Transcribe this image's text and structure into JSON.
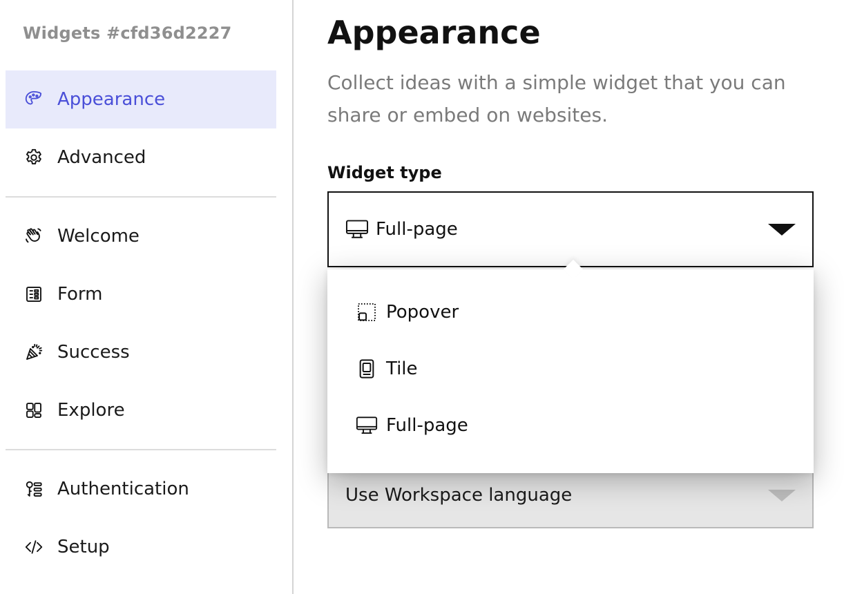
{
  "sidebar": {
    "title": "Widgets #cfd36d2227",
    "items": [
      {
        "label": "Appearance",
        "icon": "palette-icon",
        "active": true
      },
      {
        "label": "Advanced",
        "icon": "gear-icon"
      },
      {
        "label": "Welcome",
        "icon": "waving-hand-icon"
      },
      {
        "label": "Form",
        "icon": "form-icon"
      },
      {
        "label": "Success",
        "icon": "party-popper-icon"
      },
      {
        "label": "Explore",
        "icon": "grid-icon"
      },
      {
        "label": "Authentication",
        "icon": "key-list-icon"
      },
      {
        "label": "Setup",
        "icon": "code-icon"
      }
    ]
  },
  "main": {
    "title": "Appearance",
    "description": "Collect ideas with a simple widget that you can share or embed on websites.",
    "widget_type": {
      "label": "Widget type",
      "value": "Full-page",
      "icon": "monitor-icon",
      "options": [
        {
          "label": "Popover",
          "icon": "popover-icon"
        },
        {
          "label": "Tile",
          "icon": "tile-icon"
        },
        {
          "label": "Full-page",
          "icon": "monitor-icon"
        }
      ]
    },
    "language": {
      "value": "Use Workspace language"
    }
  },
  "colors": {
    "accent": "#4a4fd8",
    "active_bg": "#e8eafb",
    "muted_text": "#7a7a7a"
  }
}
